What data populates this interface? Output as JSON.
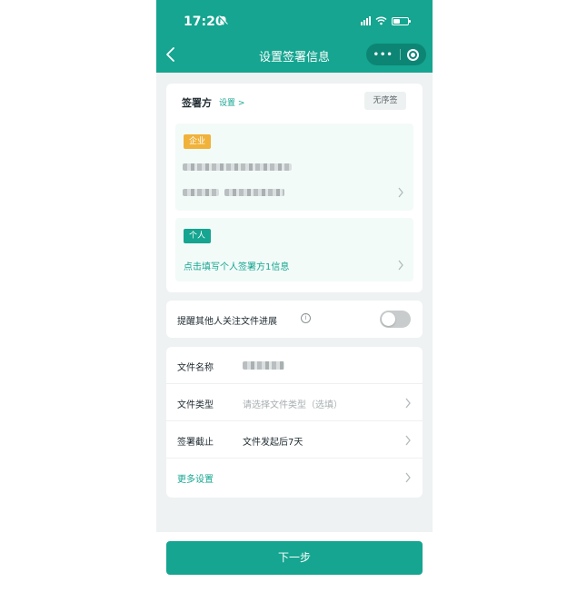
{
  "status_bar": {
    "time": "17:20"
  },
  "nav": {
    "title": "设置签署信息"
  },
  "signers": {
    "title": "签署方",
    "settings_label": "设置 >",
    "order_chip": "无序签",
    "enterprise_tag": "企业",
    "individual_tag": "个人",
    "individual_prompt": "点击填写个人签署方1信息"
  },
  "remind": {
    "label": "提醒其他人关注文件进展",
    "info_glyph": "i",
    "enabled": false
  },
  "file": {
    "name_label": "文件名称",
    "type_label": "文件类型",
    "type_placeholder": "请选择文件类型（选填）",
    "deadline_label": "签署截止",
    "deadline_value": "文件发起后7天",
    "more_label": "更多设置"
  },
  "footer": {
    "next_button": "下一步"
  },
  "colors": {
    "primary": "#15a590",
    "tag_enterprise": "#f0b23a"
  }
}
